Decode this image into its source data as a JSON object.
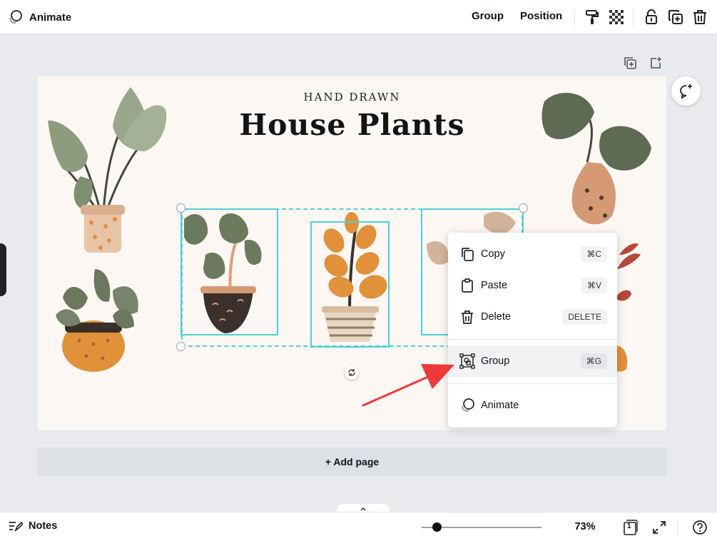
{
  "topbar": {
    "animate_label": "Animate",
    "group_label": "Group",
    "position_label": "Position",
    "icons": [
      "animate-icon",
      "paint-roller-icon",
      "transparency-icon",
      "lock-icon",
      "duplicate-icon",
      "trash-icon"
    ]
  },
  "page": {
    "subtitle": "HAND DRAWN",
    "title": "House Plants"
  },
  "canvas": {
    "add_page_label": "+ Add page"
  },
  "context_menu": {
    "items": [
      {
        "label": "Copy",
        "shortcut": "⌘C",
        "icon": "copy-icon"
      },
      {
        "label": "Paste",
        "shortcut": "⌘V",
        "icon": "clipboard-icon"
      },
      {
        "label": "Delete",
        "shortcut": "DELETE",
        "icon": "trash-icon"
      },
      {
        "label": "Group",
        "shortcut": "⌘G",
        "icon": "group-icon",
        "highlighted": true
      },
      {
        "label": "Animate",
        "shortcut": "",
        "icon": "animate-icon"
      }
    ]
  },
  "bottombar": {
    "notes_label": "Notes",
    "zoom_label": "73%",
    "zoom_fraction": 0.1,
    "page_number": "1"
  },
  "colors": {
    "selection": "#4dd0d8",
    "page_background": "#fdf7f3",
    "arrow": "#ee3a3a"
  }
}
